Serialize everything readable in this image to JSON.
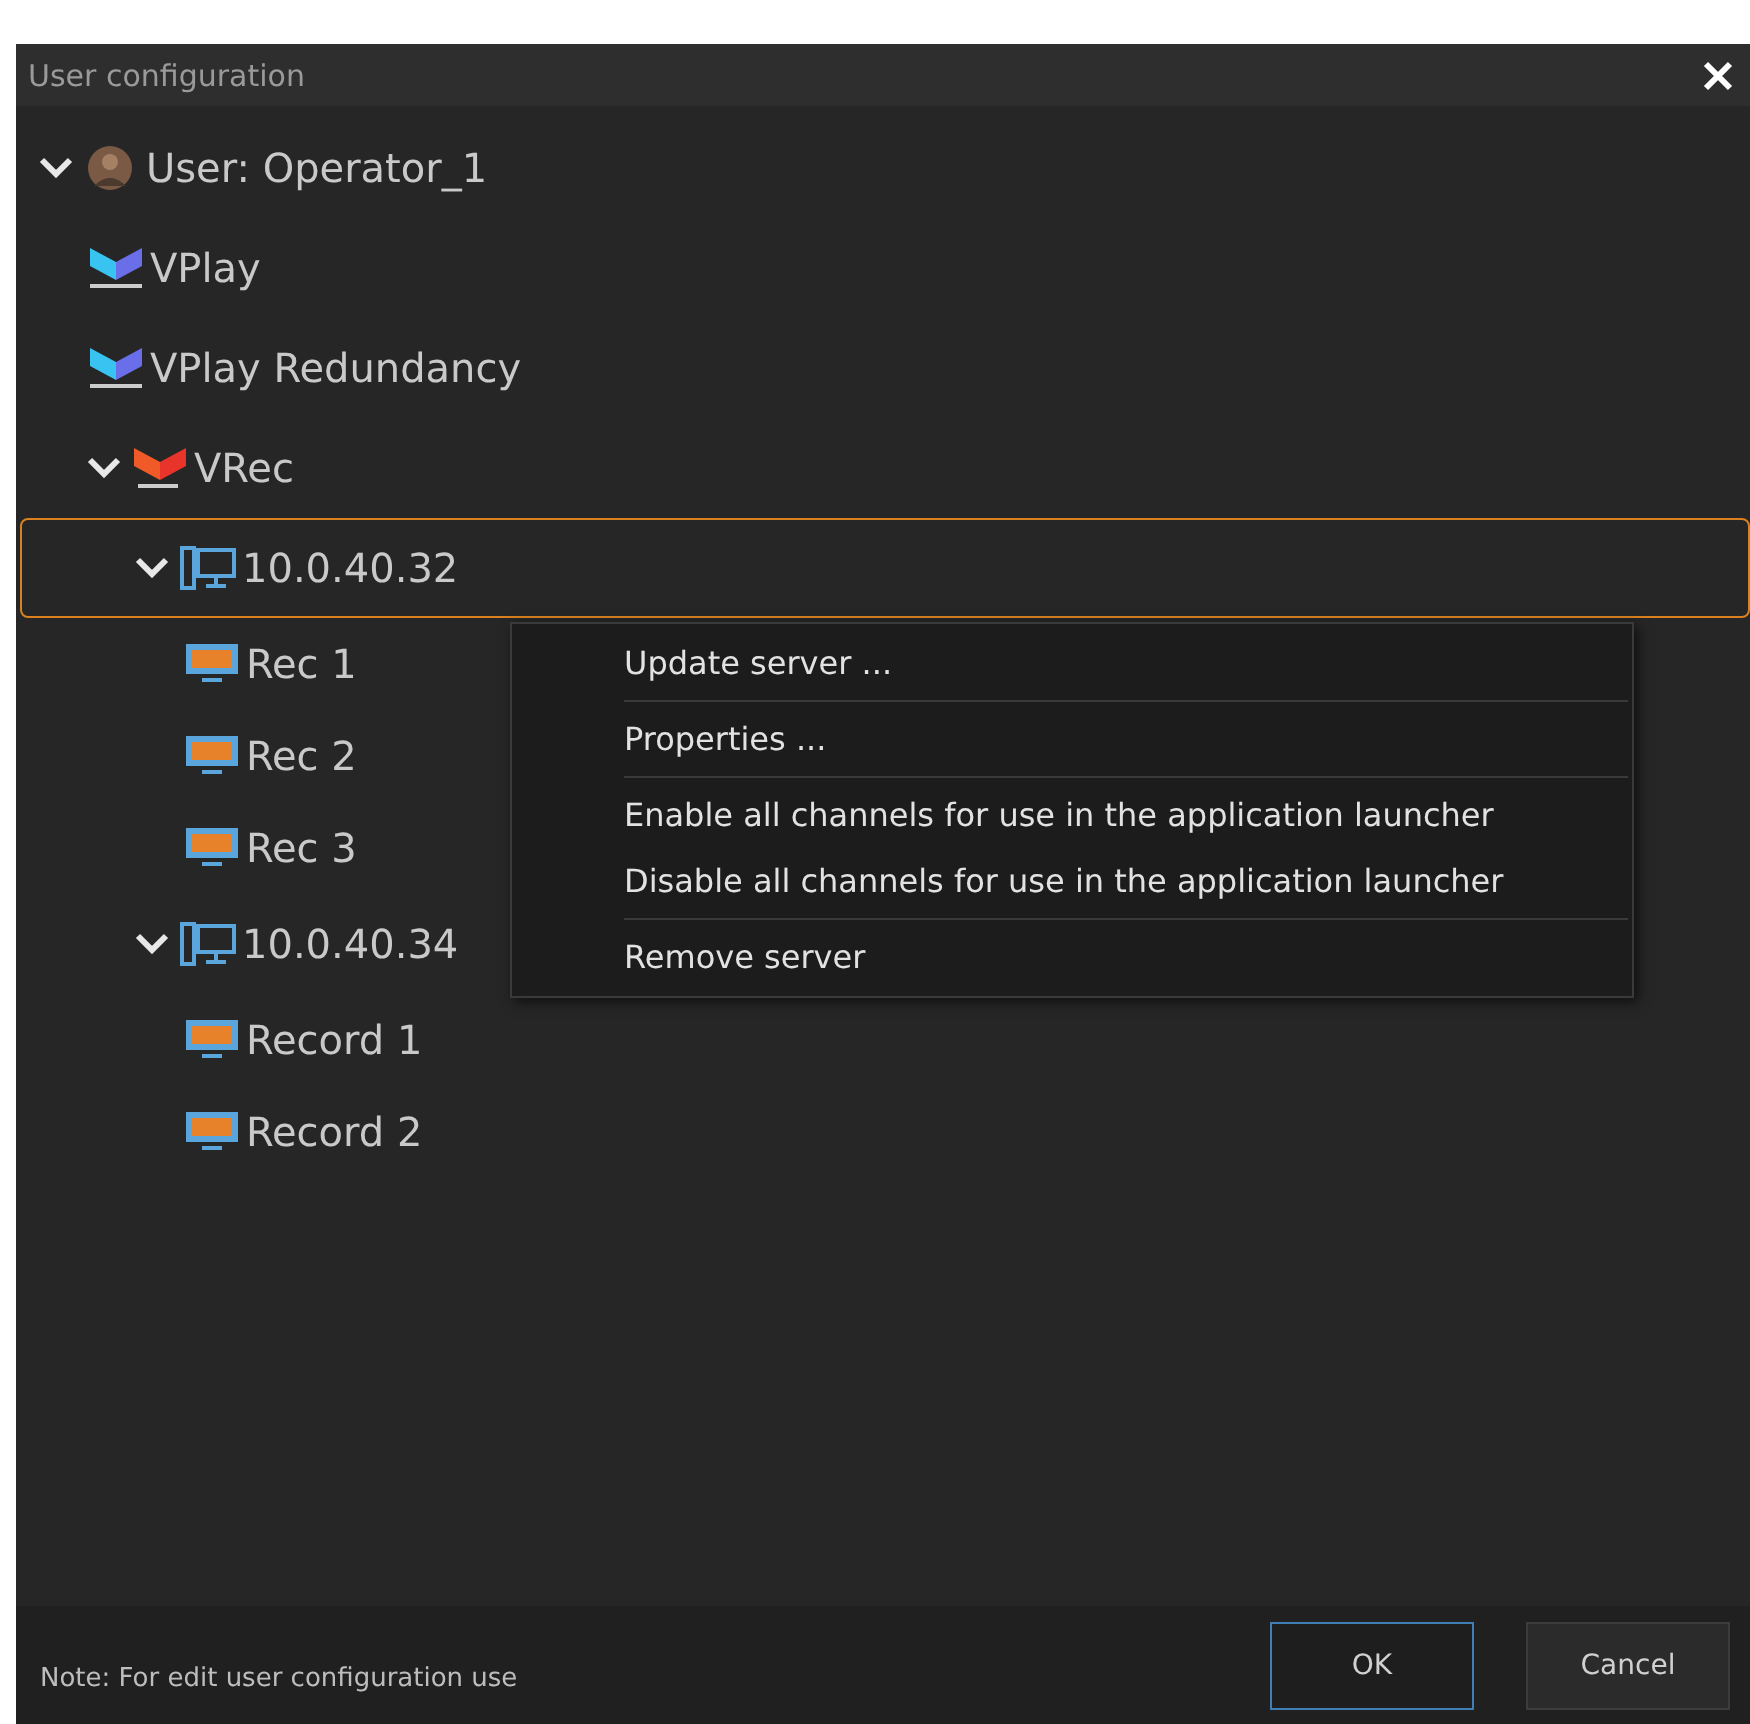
{
  "window": {
    "title": "User configuration"
  },
  "tree": [
    {
      "label": "User: Operator_1",
      "kind": "user",
      "expanded": true,
      "selected": false,
      "children": [
        {
          "label": "VPlay",
          "kind": "vplay",
          "selected": false
        },
        {
          "label": "VPlay Redundancy",
          "kind": "vplay",
          "selected": false
        },
        {
          "label": "VRec",
          "kind": "vrec",
          "expanded": true,
          "selected": false,
          "children": [
            {
              "label": "10.0.40.32",
              "kind": "server",
              "expanded": true,
              "selected": true,
              "children": [
                {
                  "label": "Rec 1",
                  "kind": "udp",
                  "selected": false
                },
                {
                  "label": "Rec 2",
                  "kind": "udp",
                  "selected": false
                },
                {
                  "label": "Rec 3",
                  "kind": "udp",
                  "selected": false
                }
              ]
            },
            {
              "label": "10.0.40.34",
              "kind": "server",
              "expanded": true,
              "selected": false,
              "children": [
                {
                  "label": "Record 1",
                  "kind": "udp",
                  "selected": false
                },
                {
                  "label": "Record 2",
                  "kind": "udp",
                  "selected": false
                }
              ]
            }
          ]
        }
      ]
    }
  ],
  "context_menu": {
    "groups": [
      [
        "Update server ..."
      ],
      [
        "Properties ..."
      ],
      [
        "Enable all channels for use in the application launcher",
        "Disable all channels for use in the application launcher"
      ],
      [
        "Remove server"
      ]
    ]
  },
  "footer": {
    "note": "Note: For edit user configuration use",
    "buttons": [
      {
        "label": "OK",
        "focused": true
      },
      {
        "label": "Cancel",
        "focused": false
      }
    ]
  }
}
